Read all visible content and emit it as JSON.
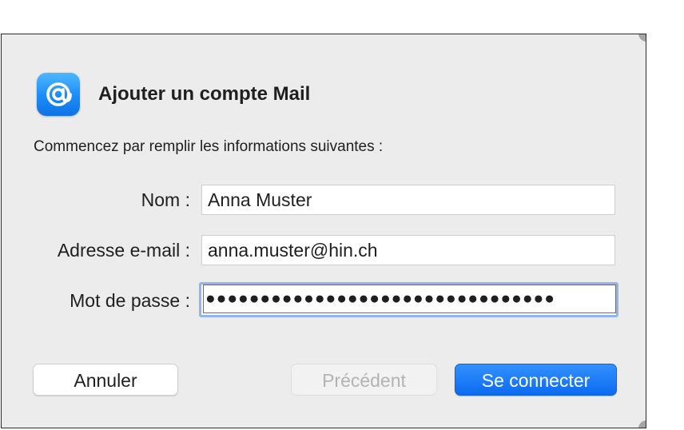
{
  "dialog": {
    "title": "Ajouter un compte Mail",
    "subtitle": "Commencez par remplir les informations suivantes :",
    "app_icon": "at-sign-mail-icon"
  },
  "form": {
    "name_label": "Nom :",
    "name_value": "Anna Muster",
    "email_label": "Adresse e-mail :",
    "email_value": "anna.muster@hin.ch",
    "password_label": "Mot de passe :",
    "password_value": "●●●●●●●●●●●●●●●●●●●●●●●●●●●●●●●●"
  },
  "buttons": {
    "cancel_label": "Annuler",
    "previous_label": "Précédent",
    "connect_label": "Se connecter"
  },
  "colors": {
    "accent": "#0b6bf0",
    "focus_ring": "#8fb4f2",
    "dialog_bg": "#ececec"
  }
}
